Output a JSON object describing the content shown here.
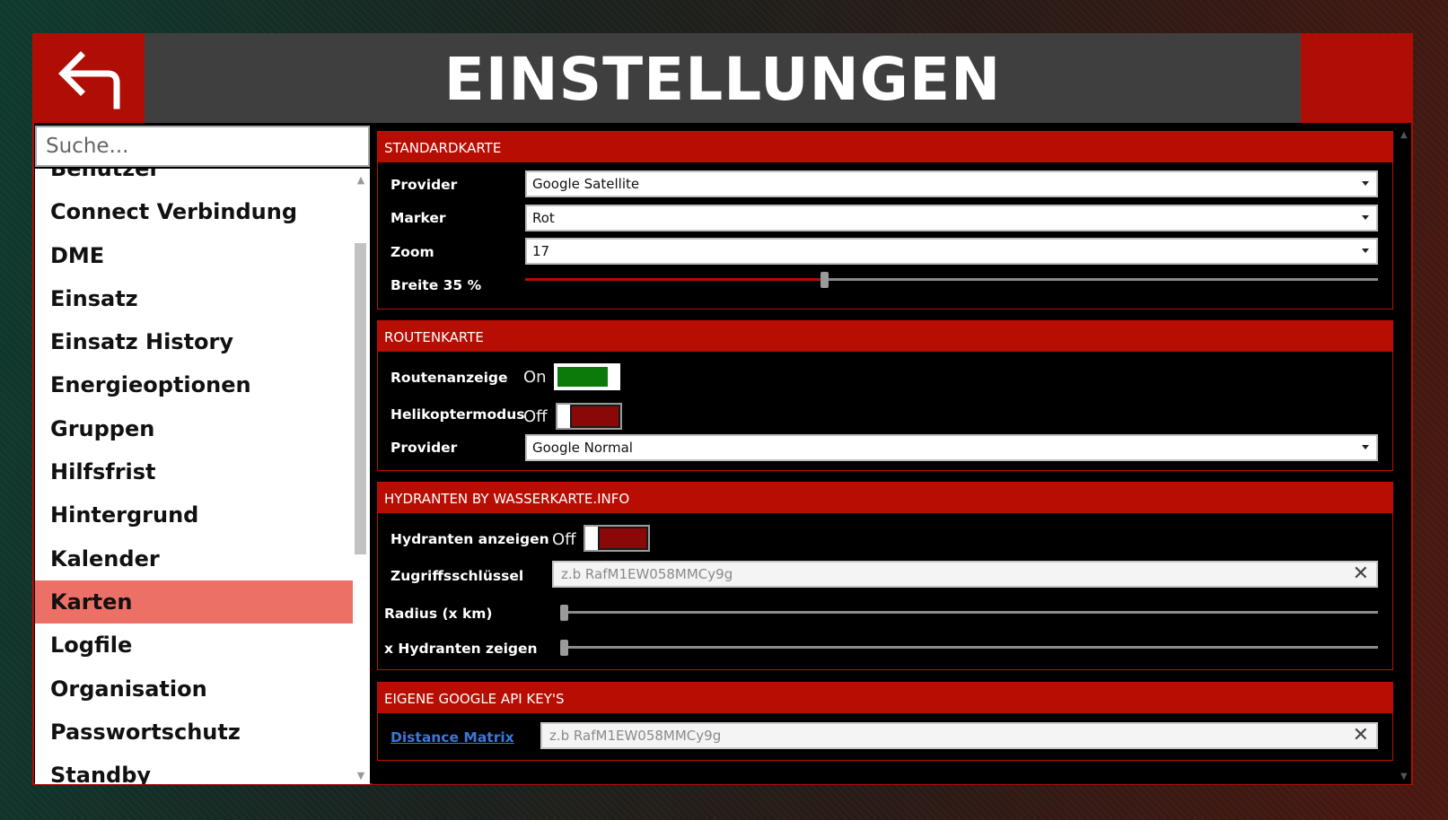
{
  "header": {
    "title": "EINSTELLUNGEN",
    "back_icon": "back-arrow-icon"
  },
  "search": {
    "placeholder": "Suche..."
  },
  "sidebar": {
    "items": [
      {
        "label": "Benutzer"
      },
      {
        "label": "Connect Verbindung"
      },
      {
        "label": "DME"
      },
      {
        "label": "Einsatz"
      },
      {
        "label": "Einsatz History"
      },
      {
        "label": "Energieoptionen"
      },
      {
        "label": "Gruppen"
      },
      {
        "label": "Hilfsfrist"
      },
      {
        "label": "Hintergrund"
      },
      {
        "label": "Kalender"
      },
      {
        "label": "Karten"
      },
      {
        "label": "Logfile"
      },
      {
        "label": "Organisation"
      },
      {
        "label": "Passwortschutz"
      },
      {
        "label": "Standby"
      }
    ],
    "active": "Karten"
  },
  "standardkarte": {
    "title": "STANDARDKARTE",
    "provider_label": "Provider",
    "provider_value": "Google Satellite",
    "marker_label": "Marker",
    "marker_value": "Rot",
    "zoom_label": "Zoom",
    "zoom_value": "17",
    "breite_label": "Breite 35 %",
    "breite_percent": 35
  },
  "routenkarte": {
    "title": "ROUTENKARTE",
    "routenanzeige_label": "Routenanzeige",
    "routenanzeige_state": "On",
    "helikopter_label": "Helikoptermodus",
    "helikopter_state": "Off",
    "provider_label": "Provider",
    "provider_value": "Google Normal"
  },
  "hydranten": {
    "title": "HYDRANTEN BY WASSERKARTE.INFO",
    "anzeigen_label": "Hydranten anzeigen",
    "anzeigen_state": "Off",
    "key_label": "Zugriffsschlüssel",
    "key_placeholder": "z.b RafM1EW058MMCy9g",
    "radius_label": "Radius (x km)",
    "radius_value": 0,
    "count_label": "x Hydranten zeigen",
    "count_value": 0
  },
  "google_keys": {
    "title": "EIGENE GOOGLE API KEY'S",
    "distance_label": "Distance Matrix",
    "distance_placeholder": "z.b RafM1EW058MMCy9g"
  },
  "colors": {
    "accent": "#b70d03",
    "active_item": "#ec7065",
    "toggle_on": "#0b7a0b",
    "toggle_off": "#8a0808"
  }
}
